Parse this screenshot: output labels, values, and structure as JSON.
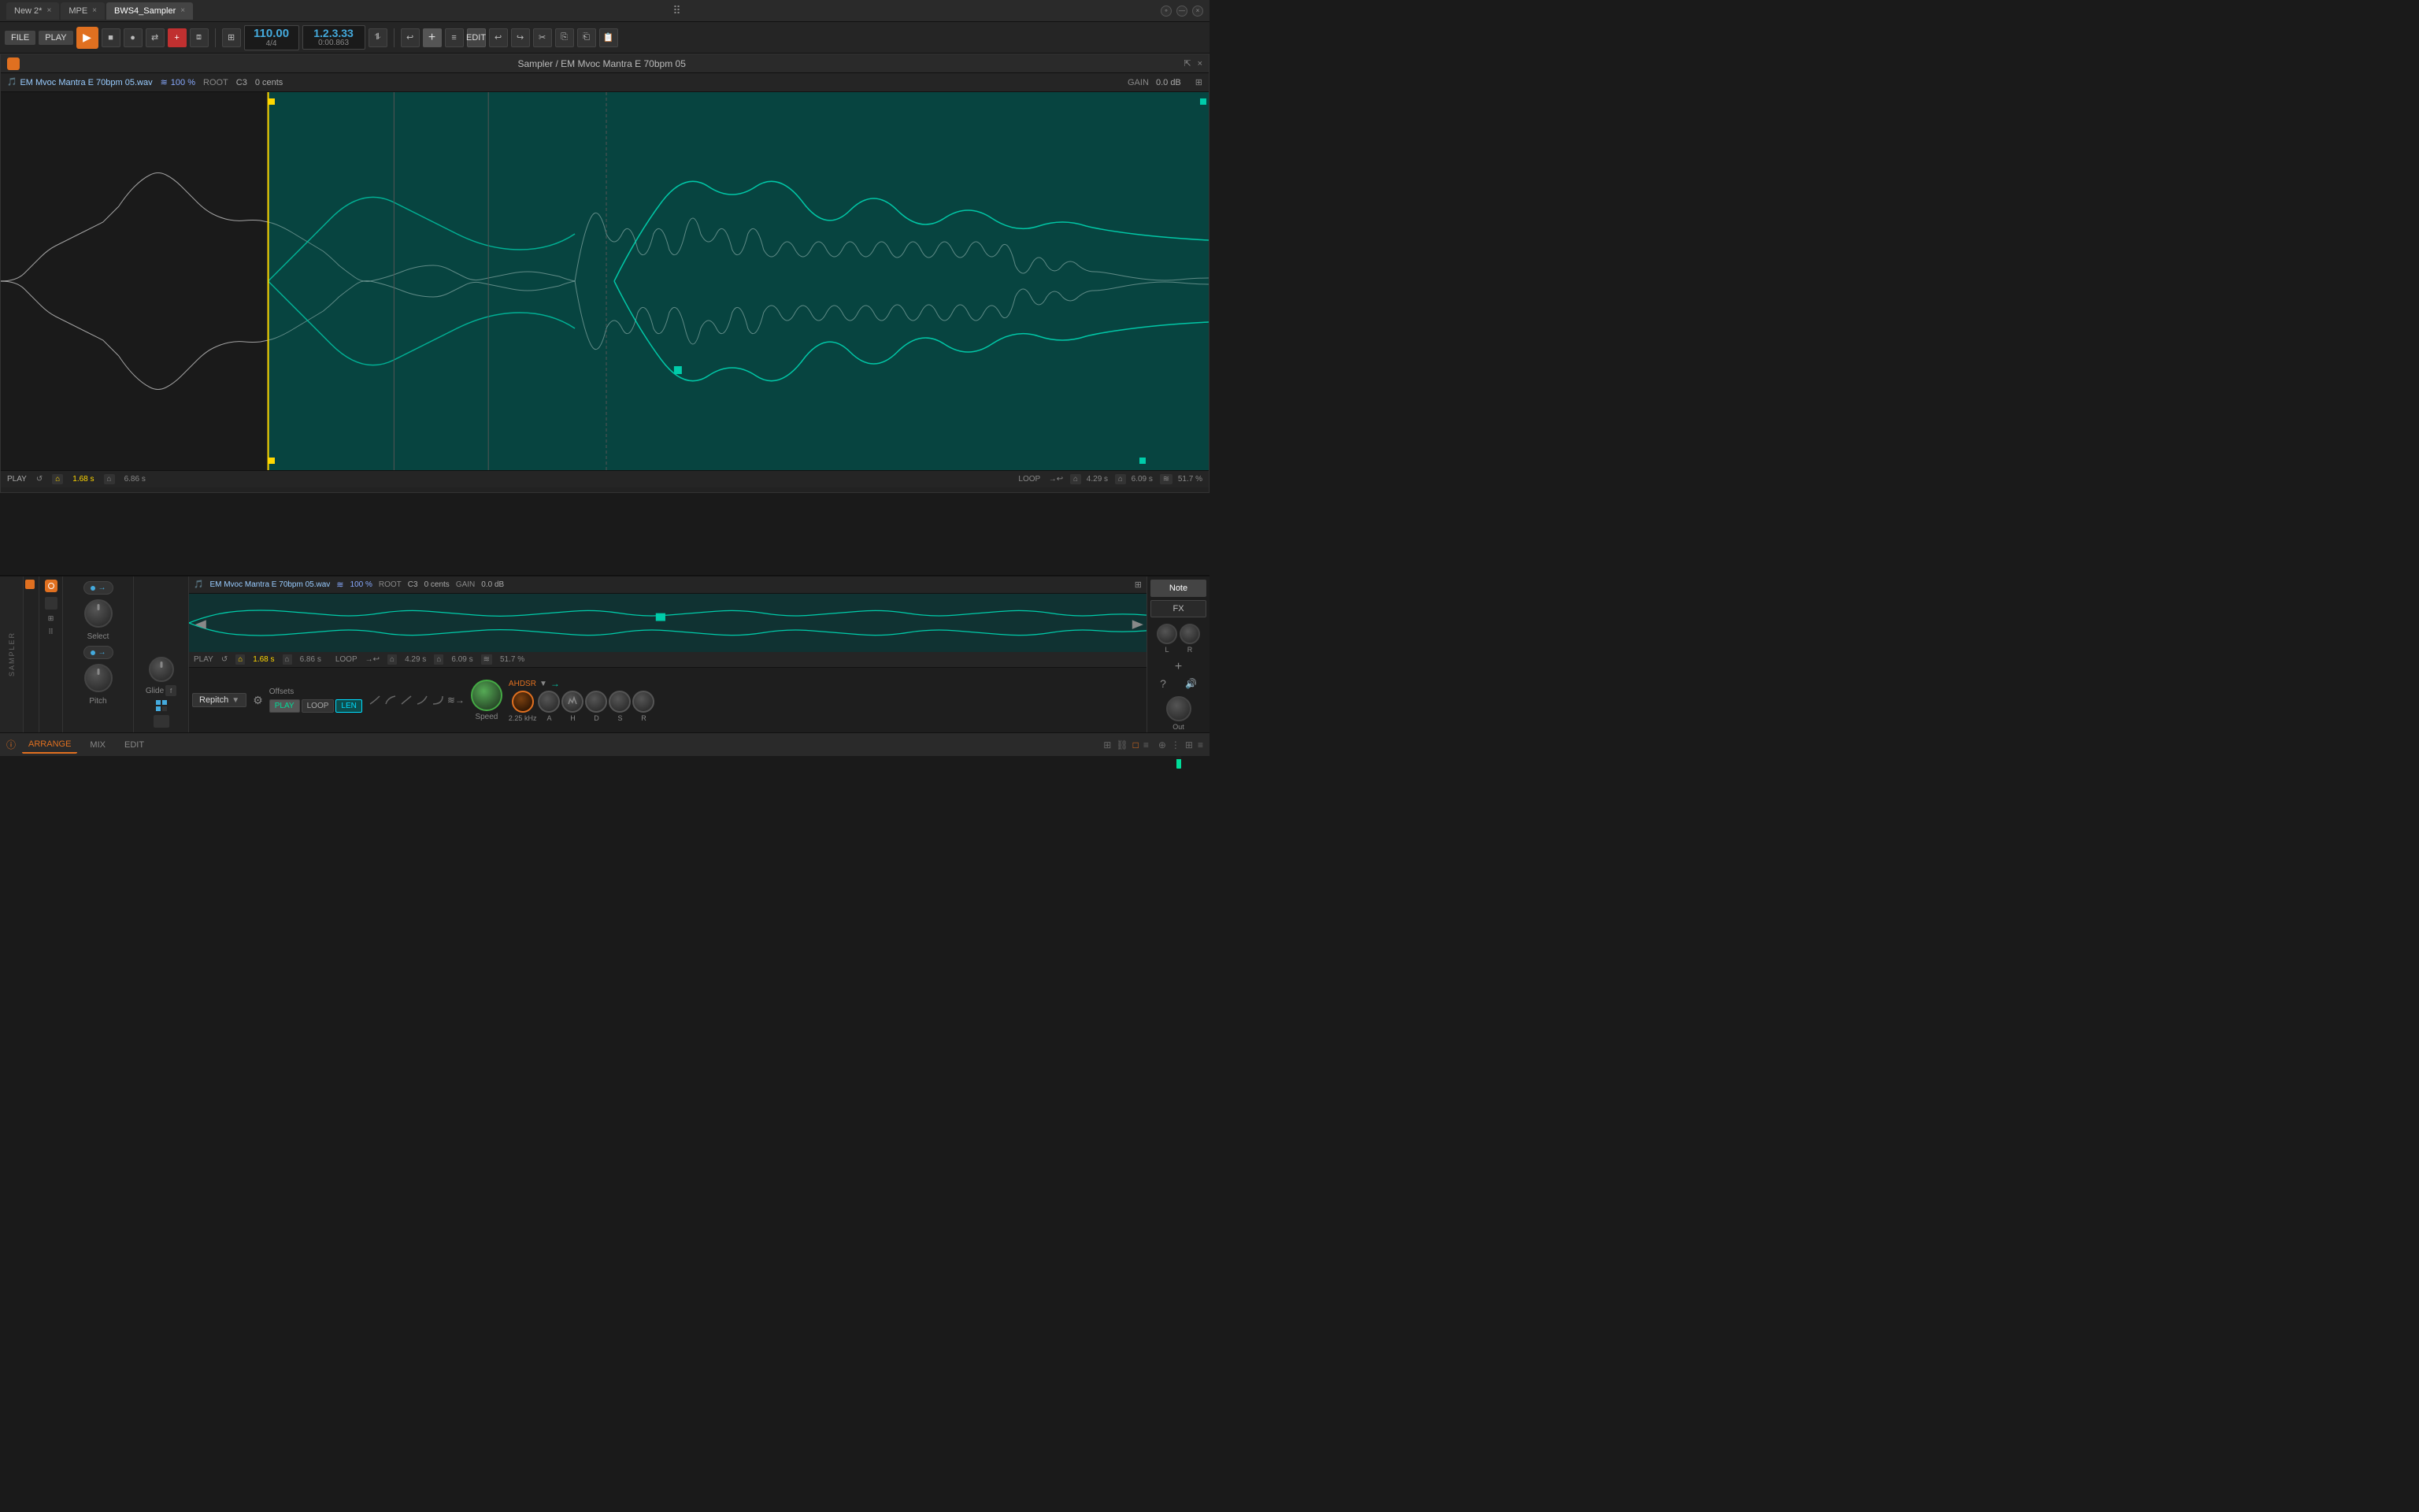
{
  "tabs": [
    {
      "label": "New 2*",
      "active": false,
      "closable": true
    },
    {
      "label": "MPE",
      "active": false,
      "closable": true
    },
    {
      "label": "BWS4_Sampler",
      "active": true,
      "closable": true
    }
  ],
  "transport": {
    "file_label": "FILE",
    "play_label": "PLAY",
    "add_label": "ADD",
    "edit_label": "EDIT",
    "tempo": "110.00",
    "time_sig": "4/4",
    "position": "1.2.3.33",
    "position_time": "0:00.863"
  },
  "sampler_window": {
    "title": "Sampler / EM Mvoc Mantra E 70bpm 05",
    "filename": "EM Mvoc Mantra E 70bpm 05.wav",
    "zoom": "100 %",
    "root": "C3",
    "root_cents": "0 cents",
    "gain": "0.0 dB"
  },
  "waveform": {
    "play_status": "PLAY",
    "start_time": "1.68 s",
    "end_time": "6.86 s",
    "loop_label": "LOOP",
    "loop_start": "4.29 s",
    "loop_end": "6.09 s",
    "loop_pct": "51.7 %"
  },
  "lower": {
    "select_label": "Select",
    "pitch_label": "Pitch",
    "glide_label": "Glide",
    "note_btn": "Note",
    "fx_btn": "FX",
    "repitch_label": "Repitch",
    "offsets_label": "Offsets",
    "play_btn": "PLAY",
    "loop_btn": "LOOP",
    "len_btn": "LEN",
    "speed_label": "Speed",
    "freq_label": "2.25 kHz",
    "ahdsr_label": "AHDSR",
    "env_labels": [
      "A",
      "H",
      "D",
      "S",
      "R"
    ],
    "out_label": "Out",
    "lr_labels": [
      "L",
      "R"
    ],
    "question_label": "?",
    "speaker_label": "🔊"
  },
  "bottom_bar": {
    "arrange_label": "ARRANGE",
    "mix_label": "MIX",
    "edit_label": "EDIT"
  }
}
